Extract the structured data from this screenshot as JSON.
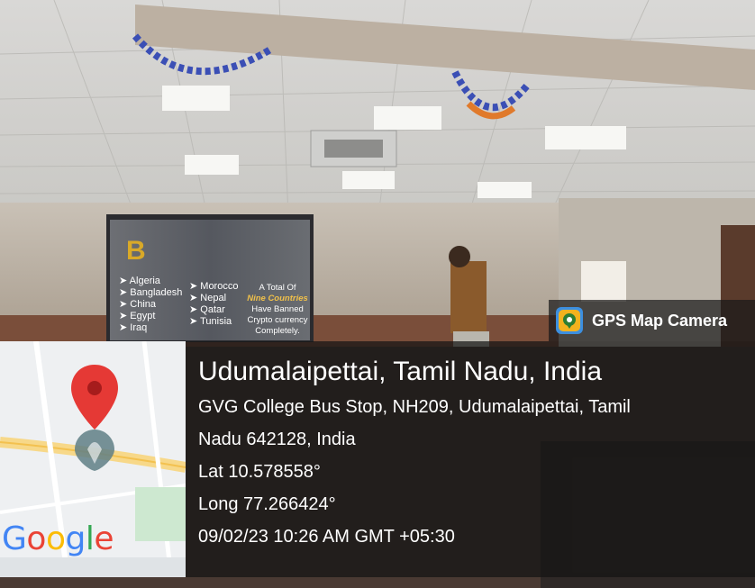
{
  "badge": {
    "app_name": "GPS Map Camera",
    "icon": "gps-map-camera-icon"
  },
  "location": {
    "title": "Udumalaipettai, Tamil Nadu, India",
    "address_line1": "GVG College Bus Stop, NH209, Udumalaipettai, Tamil",
    "address_line2": "Nadu 642128, India",
    "lat": "Lat 10.578558°",
    "long": "Long 77.266424°",
    "datetime": "09/02/23 10:26 AM GMT +05:30"
  },
  "map": {
    "logo_text": [
      "G",
      "o",
      "o",
      "g",
      "l",
      "e"
    ],
    "logo_colors": [
      "#4285F4",
      "#EA4335",
      "#FBBC05",
      "#4285F4",
      "#34A853",
      "#EA4335"
    ],
    "pin_icon": "map-pin-icon"
  },
  "slide": {
    "heading": "B",
    "notice": "A Total Of",
    "notice2": "Nine Countries",
    "notice3": "Have Banned",
    "notice4": "Crypto currency",
    "notice5": "Completely.",
    "left_list": [
      "Algeria",
      "Bangladesh",
      "China",
      "Egypt",
      "Iraq"
    ],
    "right_list": [
      "Morocco",
      "Nepal",
      "Qatar",
      "Tunisia"
    ]
  }
}
